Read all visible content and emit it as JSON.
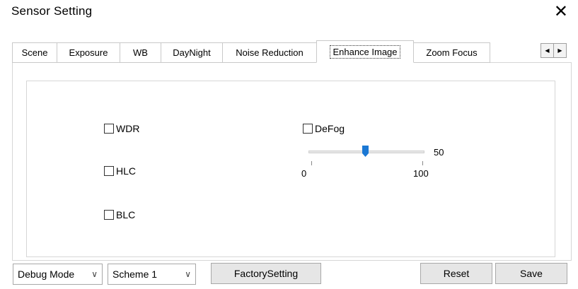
{
  "window": {
    "title": "Sensor Setting",
    "close_glyph": "✕"
  },
  "tabs": [
    {
      "label": "Scene"
    },
    {
      "label": "Exposure"
    },
    {
      "label": "WB"
    },
    {
      "label": "DayNight"
    },
    {
      "label": "Noise Reduction"
    },
    {
      "label": "Enhance Image",
      "active": true
    },
    {
      "label": "Zoom Focus"
    }
  ],
  "tab_scroll": {
    "left_glyph": "◀",
    "right_glyph": "▶"
  },
  "enhance": {
    "wdr_label": "WDR",
    "wdr_checked": false,
    "hlc_label": "HLC",
    "hlc_checked": false,
    "blc_label": "BLC",
    "blc_checked": false,
    "defog_label": "DeFog",
    "defog_checked": false,
    "defog_slider": {
      "value": "50",
      "min": "0",
      "max": "100"
    }
  },
  "bottom": {
    "debug_mode": "Debug Mode",
    "scheme": "Scheme 1",
    "chevron": "∨",
    "factory_label": "FactorySetting",
    "reset_label": "Reset",
    "save_label": "Save"
  },
  "colors": {
    "slider_thumb": "#1b78d4",
    "button_face": "#e6e6e6"
  }
}
